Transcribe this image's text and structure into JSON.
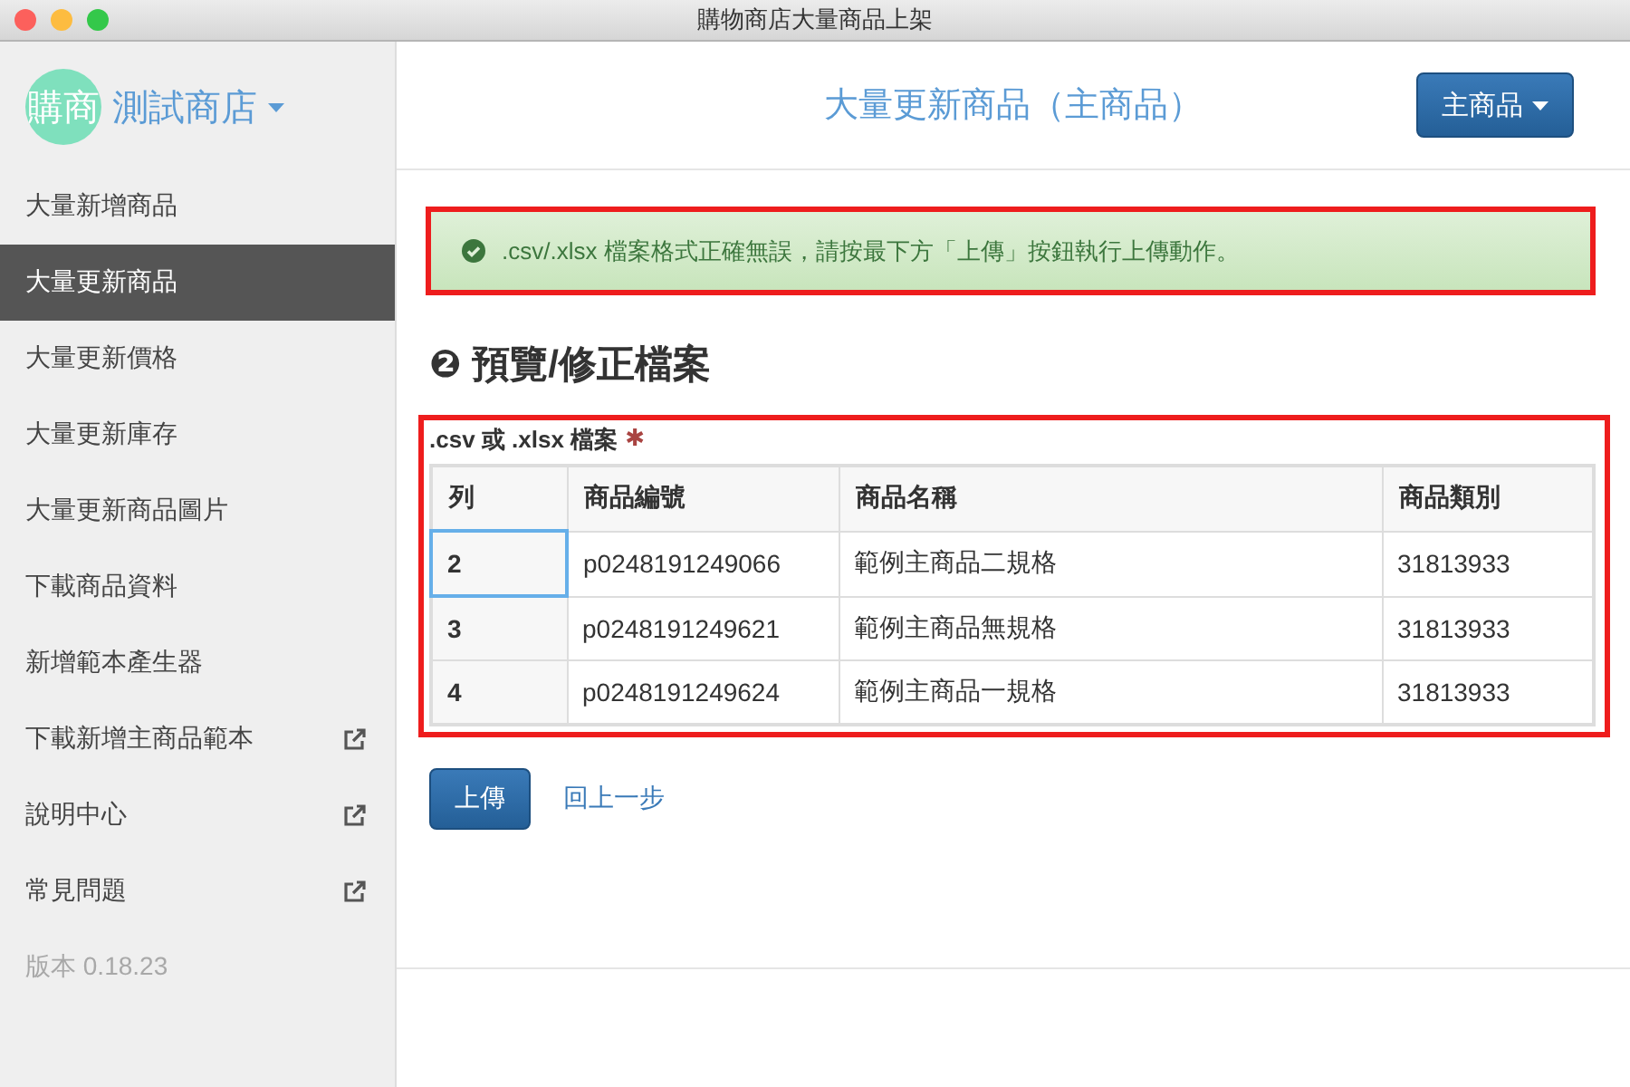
{
  "window": {
    "title": "購物商店大量商品上架"
  },
  "store": {
    "avatar": "購商",
    "name": "測試商店"
  },
  "sidebar": {
    "items": [
      {
        "label": "大量新增商品",
        "selected": false,
        "external": false
      },
      {
        "label": "大量更新商品",
        "selected": true,
        "external": false
      },
      {
        "label": "大量更新價格",
        "selected": false,
        "external": false
      },
      {
        "label": "大量更新庫存",
        "selected": false,
        "external": false
      },
      {
        "label": "大量更新商品圖片",
        "selected": false,
        "external": false
      },
      {
        "label": "下載商品資料",
        "selected": false,
        "external": false
      },
      {
        "label": "新增範本產生器",
        "selected": false,
        "external": false
      },
      {
        "label": "下載新增主商品範本",
        "selected": false,
        "external": true
      },
      {
        "label": "說明中心",
        "selected": false,
        "external": true
      },
      {
        "label": "常見問題",
        "selected": false,
        "external": true
      }
    ],
    "version": "版本 0.18.23"
  },
  "header": {
    "title": "大量更新商品（主商品）",
    "dropdown": "主商品"
  },
  "alert": {
    "text": ".csv/.xlsx 檔案格式正確無誤，請按最下方「上傳」按鈕執行上傳動作。",
    "highlighted": true
  },
  "section": {
    "number": "❷",
    "title": "預覽/修正檔案"
  },
  "file_table": {
    "label": ".csv 或 .xlsx 檔案",
    "required": true,
    "required_mark": "✱",
    "highlighted": true,
    "columns": [
      "列",
      "商品編號",
      "商品名稱",
      "商品類別"
    ],
    "rows": [
      {
        "cells": [
          "2",
          "p0248191249066",
          "範例主商品二規格",
          "31813933"
        ],
        "focused": true
      },
      {
        "cells": [
          "3",
          "p0248191249621",
          "範例主商品無規格",
          "31813933"
        ],
        "focused": false
      },
      {
        "cells": [
          "4",
          "p0248191249624",
          "範例主商品一規格",
          "31813933"
        ],
        "focused": false
      }
    ]
  },
  "actions": {
    "upload": "上傳",
    "back": "回上一步"
  }
}
